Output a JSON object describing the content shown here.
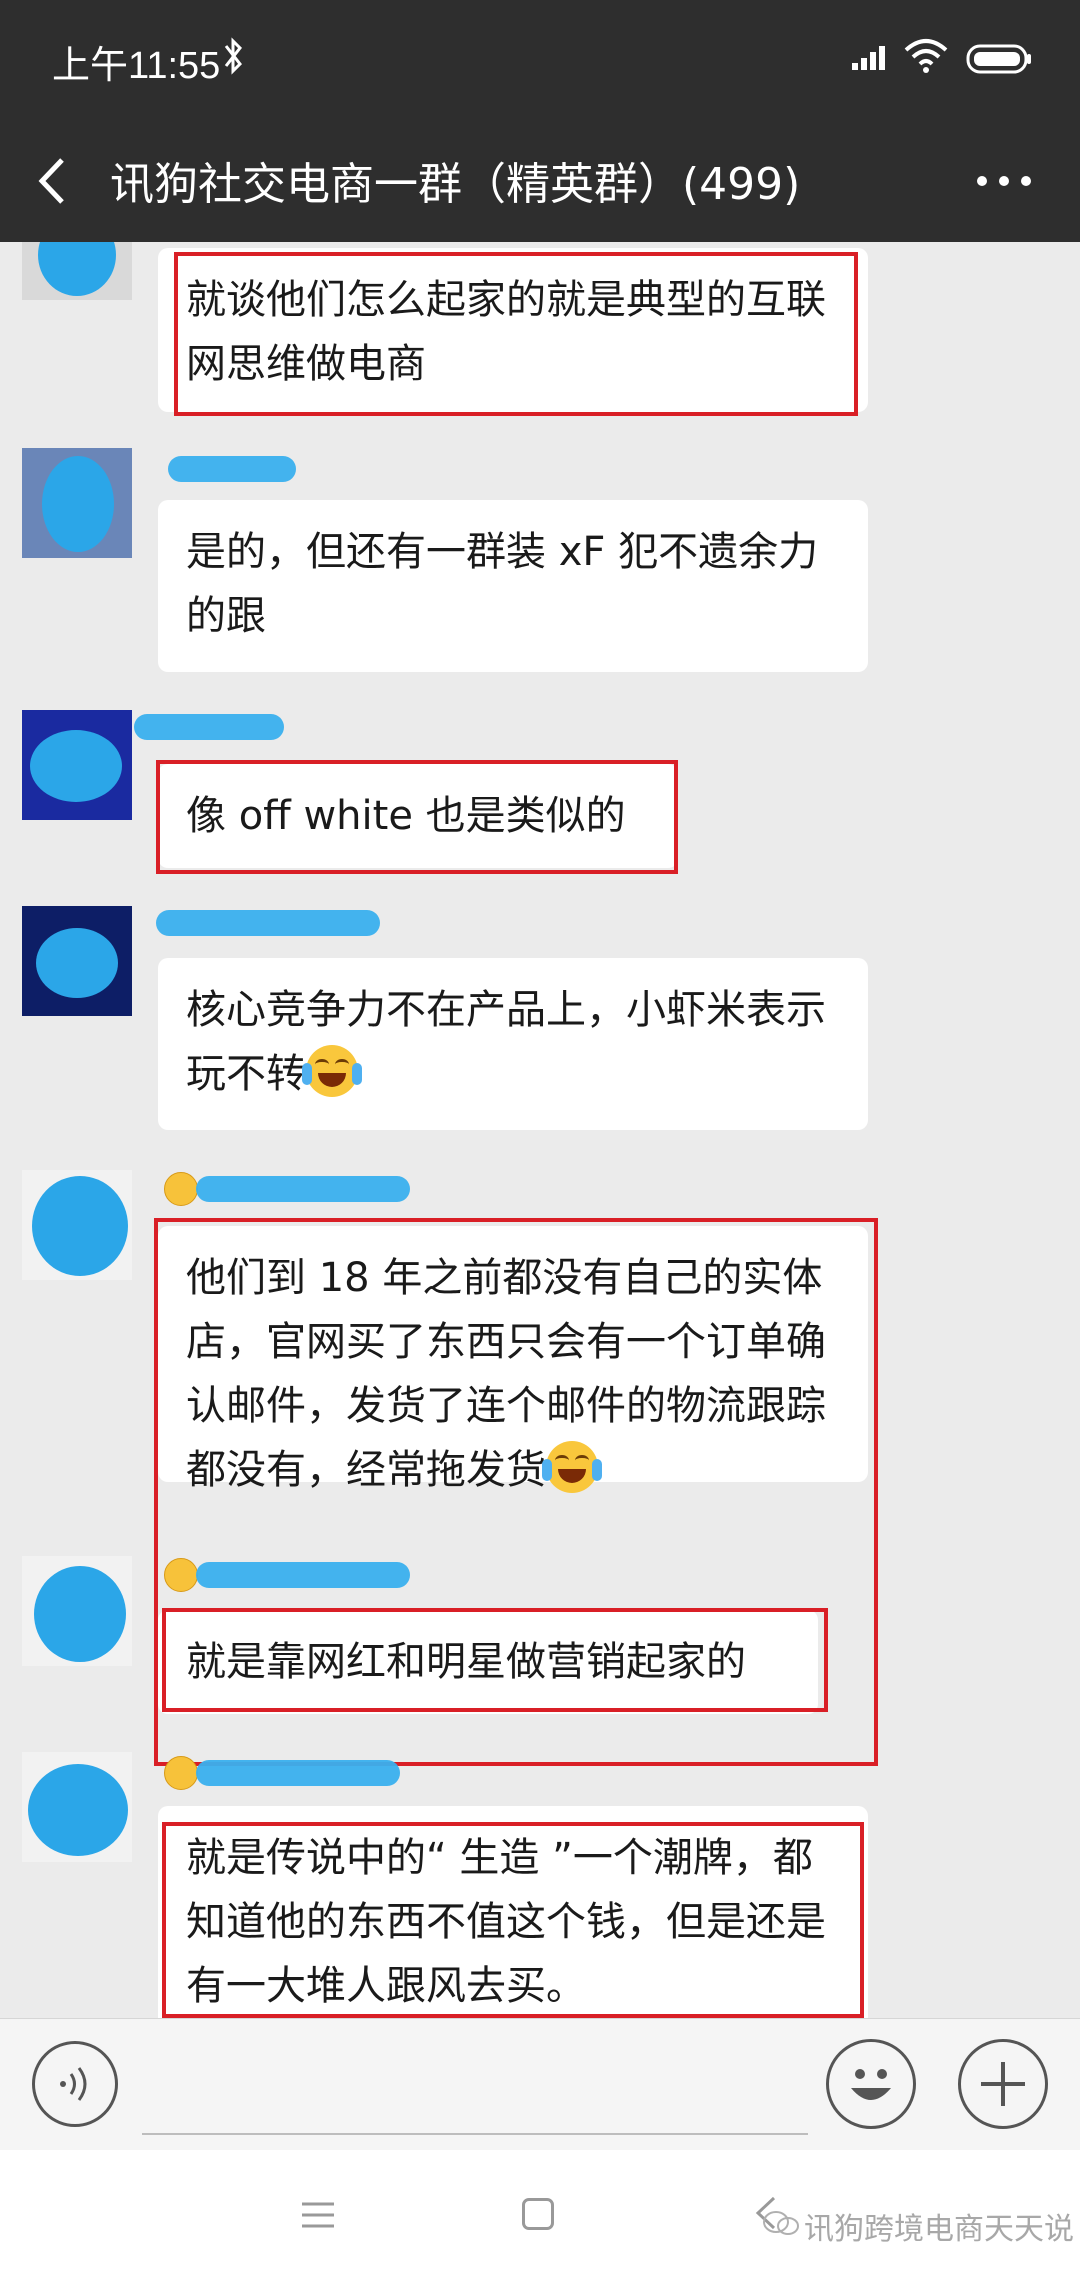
{
  "status_bar": {
    "time": "上午11:55",
    "icons": [
      "bluetooth-icon",
      "signal-icon",
      "wifi-icon",
      "battery-icon"
    ]
  },
  "header": {
    "title": "讯狗社交电商一群（精英群）(499)",
    "back_icon": "chevron-left-icon",
    "more_icon": "more-dots-icon"
  },
  "messages": [
    {
      "text": "就谈他们怎么起家的就是典型的互联网思维做电商",
      "highlighted": true
    },
    {
      "text": "是的，但还有一群装 xF 犯不遗余力的跟",
      "highlighted": false
    },
    {
      "text": "像 off white 也是类似的",
      "highlighted": true
    },
    {
      "text": "核心竞争力不在产品上，小虾米表示玩不转",
      "emoji": "face-with-tears-of-joy",
      "highlighted": false
    },
    {
      "text": "他们到 18 年之前都没有自己的实体店，官网买了东西只会有一个订单确认邮件，发货了连个邮件的物流跟踪都没有，经常拖发货",
      "emoji": "face-with-tears-of-joy",
      "highlighted": true
    },
    {
      "text": "就是靠网红和明星做营销起家的",
      "highlighted": true
    },
    {
      "text": "就是传说中的“ 生造 ”一个潮牌，都知道他的东西不值这个钱，但是还是有一大堆人跟风去买。",
      "highlighted": true
    }
  ],
  "input_bar": {
    "placeholder": "",
    "icons": [
      "voice-icon",
      "emoji-icon",
      "plus-icon"
    ]
  },
  "nav_bar": {
    "watermark": "讯狗跨境电商天天说"
  },
  "colors": {
    "header_bg": "#2e2e2e",
    "chat_bg": "#ebebeb",
    "highlight": "#d91f26",
    "avatar_scribble": "#2ba6e8"
  }
}
